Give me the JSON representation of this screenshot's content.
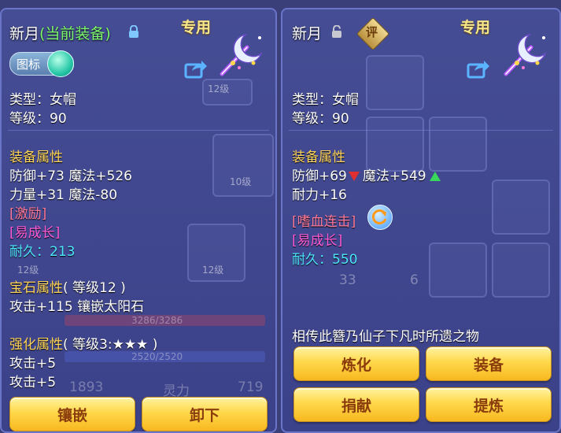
{
  "left": {
    "name": "新月",
    "tag_current": "(当前装备)",
    "special": "专用",
    "icon_toggle_label": "图标",
    "type_line": "类型：女帽",
    "level_line": "等级：90",
    "attr_header": "装备属性",
    "attr1": "防御+73 魔法+526",
    "attr2": "力量+31 魔法-80",
    "tag_encourage": "[激励]",
    "tag_grow": "[易成长]",
    "durability_label": "耐久：",
    "durability_value": "213",
    "gem_header": "宝石属性",
    "gem_level": "( 等级12 )",
    "gem_line": "攻击+115 镶嵌太阳石",
    "forge_header": "强化属性",
    "forge_level": "( 等级3:★★★ )",
    "forge1": "攻击+5",
    "forge2": "攻击+5",
    "buttons": [
      "镶嵌",
      "卸下"
    ]
  },
  "right": {
    "name": "新月",
    "badge": "评",
    "special": "专用",
    "type_line": "类型：女帽",
    "level_line": "等级：90",
    "attr_header": "装备属性",
    "attr_def": "防御+69",
    "attr_mag": "魔法+549",
    "attr2": "耐力+16",
    "tag_skill": "[嗜血连击]",
    "tag_grow": "[易成长]",
    "durability_label": "耐久：",
    "durability_value": "550",
    "lore": "相传此簪乃仙子下凡时所遗之物",
    "buttons": [
      "炼化",
      "装备",
      "捐献",
      "提炼"
    ]
  },
  "background_text": {
    "level_badges": [
      "12级",
      "10级",
      "12级",
      "12级"
    ],
    "hp_bar": "3286/3286",
    "mp_bar": "2520/2520",
    "stat_a": "1893",
    "stat_b_label": "灵力",
    "stat_b": "719",
    "slot_count_a": "33",
    "slot_count_b": "6"
  },
  "colors": {
    "title_green": "#7cf86a",
    "section_gold": "#ffd55a",
    "durability_cyan": "#4de6ff",
    "button_gold": "#ffd84a"
  }
}
